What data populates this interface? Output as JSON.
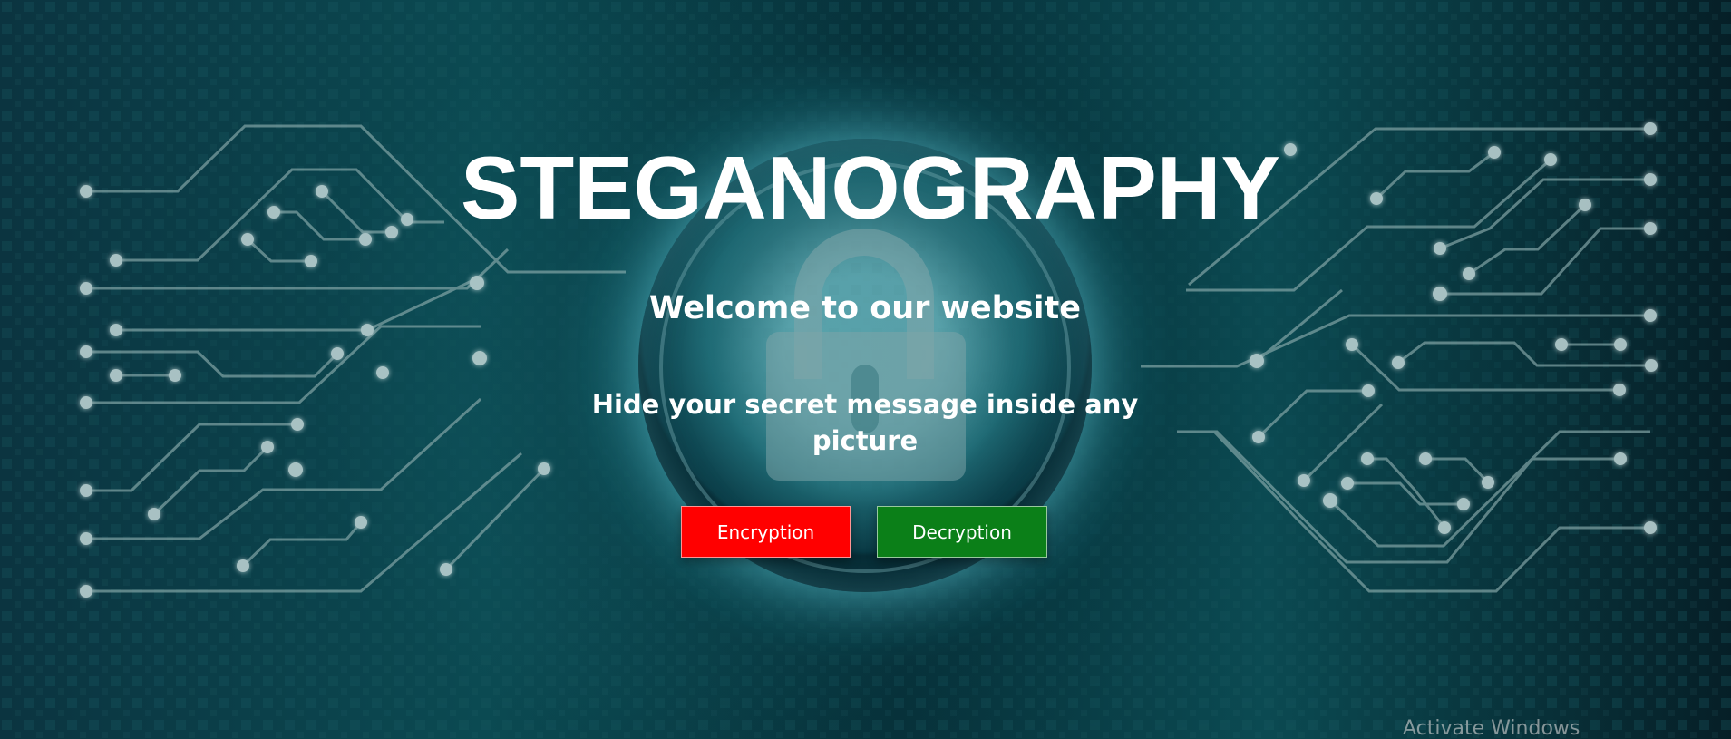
{
  "hero": {
    "title": "STEGANOGRAPHY",
    "welcome": "Welcome to our website",
    "subtitle": "Hide your secret message inside any picture"
  },
  "actions": {
    "encryption": "Encryption",
    "decryption": "Decryption"
  },
  "system": {
    "watermark": "Activate Windows"
  },
  "decor": {
    "background_icon": "circuit-board-lock-icon",
    "primary_glow": "#5bb9c4",
    "encryption_color": "#ff0000",
    "decryption_color": "#0b7f18"
  }
}
